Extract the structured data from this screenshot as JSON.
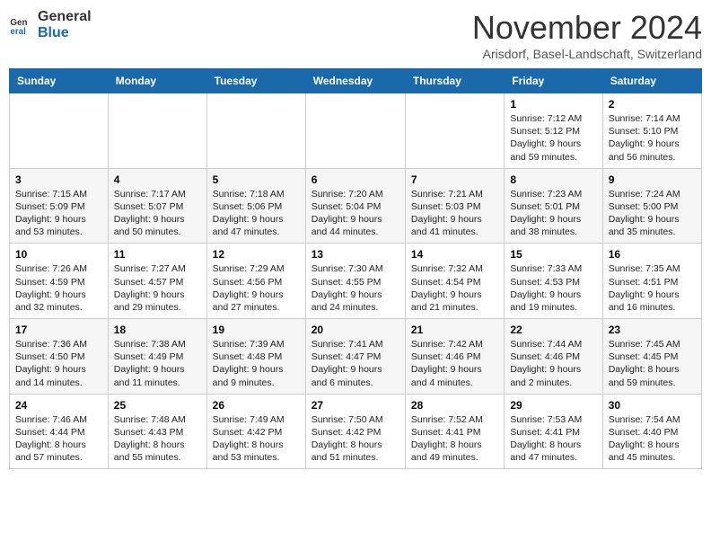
{
  "logo": {
    "line1": "General",
    "line2": "Blue"
  },
  "title": "November 2024",
  "subtitle": "Arisdorf, Basel-Landschaft, Switzerland",
  "days_of_week": [
    "Sunday",
    "Monday",
    "Tuesday",
    "Wednesday",
    "Thursday",
    "Friday",
    "Saturday"
  ],
  "weeks": [
    [
      {
        "day": "",
        "info": ""
      },
      {
        "day": "",
        "info": ""
      },
      {
        "day": "",
        "info": ""
      },
      {
        "day": "",
        "info": ""
      },
      {
        "day": "",
        "info": ""
      },
      {
        "day": "1",
        "info": "Sunrise: 7:12 AM\nSunset: 5:12 PM\nDaylight: 9 hours and 59 minutes."
      },
      {
        "day": "2",
        "info": "Sunrise: 7:14 AM\nSunset: 5:10 PM\nDaylight: 9 hours and 56 minutes."
      }
    ],
    [
      {
        "day": "3",
        "info": "Sunrise: 7:15 AM\nSunset: 5:09 PM\nDaylight: 9 hours and 53 minutes."
      },
      {
        "day": "4",
        "info": "Sunrise: 7:17 AM\nSunset: 5:07 PM\nDaylight: 9 hours and 50 minutes."
      },
      {
        "day": "5",
        "info": "Sunrise: 7:18 AM\nSunset: 5:06 PM\nDaylight: 9 hours and 47 minutes."
      },
      {
        "day": "6",
        "info": "Sunrise: 7:20 AM\nSunset: 5:04 PM\nDaylight: 9 hours and 44 minutes."
      },
      {
        "day": "7",
        "info": "Sunrise: 7:21 AM\nSunset: 5:03 PM\nDaylight: 9 hours and 41 minutes."
      },
      {
        "day": "8",
        "info": "Sunrise: 7:23 AM\nSunset: 5:01 PM\nDaylight: 9 hours and 38 minutes."
      },
      {
        "day": "9",
        "info": "Sunrise: 7:24 AM\nSunset: 5:00 PM\nDaylight: 9 hours and 35 minutes."
      }
    ],
    [
      {
        "day": "10",
        "info": "Sunrise: 7:26 AM\nSunset: 4:59 PM\nDaylight: 9 hours and 32 minutes."
      },
      {
        "day": "11",
        "info": "Sunrise: 7:27 AM\nSunset: 4:57 PM\nDaylight: 9 hours and 29 minutes."
      },
      {
        "day": "12",
        "info": "Sunrise: 7:29 AM\nSunset: 4:56 PM\nDaylight: 9 hours and 27 minutes."
      },
      {
        "day": "13",
        "info": "Sunrise: 7:30 AM\nSunset: 4:55 PM\nDaylight: 9 hours and 24 minutes."
      },
      {
        "day": "14",
        "info": "Sunrise: 7:32 AM\nSunset: 4:54 PM\nDaylight: 9 hours and 21 minutes."
      },
      {
        "day": "15",
        "info": "Sunrise: 7:33 AM\nSunset: 4:53 PM\nDaylight: 9 hours and 19 minutes."
      },
      {
        "day": "16",
        "info": "Sunrise: 7:35 AM\nSunset: 4:51 PM\nDaylight: 9 hours and 16 minutes."
      }
    ],
    [
      {
        "day": "17",
        "info": "Sunrise: 7:36 AM\nSunset: 4:50 PM\nDaylight: 9 hours and 14 minutes."
      },
      {
        "day": "18",
        "info": "Sunrise: 7:38 AM\nSunset: 4:49 PM\nDaylight: 9 hours and 11 minutes."
      },
      {
        "day": "19",
        "info": "Sunrise: 7:39 AM\nSunset: 4:48 PM\nDaylight: 9 hours and 9 minutes."
      },
      {
        "day": "20",
        "info": "Sunrise: 7:41 AM\nSunset: 4:47 PM\nDaylight: 9 hours and 6 minutes."
      },
      {
        "day": "21",
        "info": "Sunrise: 7:42 AM\nSunset: 4:46 PM\nDaylight: 9 hours and 4 minutes."
      },
      {
        "day": "22",
        "info": "Sunrise: 7:44 AM\nSunset: 4:46 PM\nDaylight: 9 hours and 2 minutes."
      },
      {
        "day": "23",
        "info": "Sunrise: 7:45 AM\nSunset: 4:45 PM\nDaylight: 8 hours and 59 minutes."
      }
    ],
    [
      {
        "day": "24",
        "info": "Sunrise: 7:46 AM\nSunset: 4:44 PM\nDaylight: 8 hours and 57 minutes."
      },
      {
        "day": "25",
        "info": "Sunrise: 7:48 AM\nSunset: 4:43 PM\nDaylight: 8 hours and 55 minutes."
      },
      {
        "day": "26",
        "info": "Sunrise: 7:49 AM\nSunset: 4:42 PM\nDaylight: 8 hours and 53 minutes."
      },
      {
        "day": "27",
        "info": "Sunrise: 7:50 AM\nSunset: 4:42 PM\nDaylight: 8 hours and 51 minutes."
      },
      {
        "day": "28",
        "info": "Sunrise: 7:52 AM\nSunset: 4:41 PM\nDaylight: 8 hours and 49 minutes."
      },
      {
        "day": "29",
        "info": "Sunrise: 7:53 AM\nSunset: 4:41 PM\nDaylight: 8 hours and 47 minutes."
      },
      {
        "day": "30",
        "info": "Sunrise: 7:54 AM\nSunset: 4:40 PM\nDaylight: 8 hours and 45 minutes."
      }
    ]
  ]
}
